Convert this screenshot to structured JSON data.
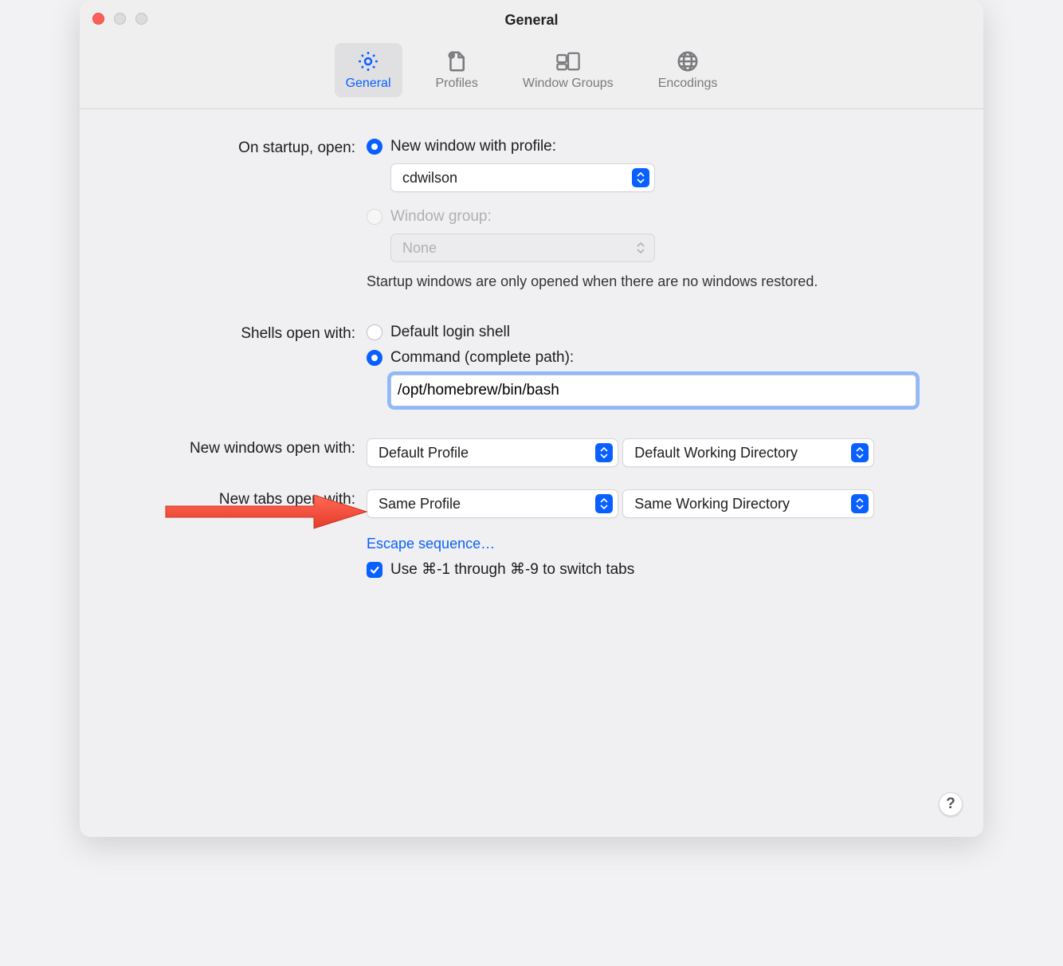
{
  "window": {
    "title": "General"
  },
  "toolbar": {
    "tabs": [
      {
        "label": "General"
      },
      {
        "label": "Profiles"
      },
      {
        "label": "Window Groups"
      },
      {
        "label": "Encodings"
      }
    ]
  },
  "startup": {
    "label": "On startup, open:",
    "option_new_window_label": "New window with profile:",
    "profile_value": "cdwilson",
    "option_window_group_label": "Window group:",
    "window_group_value": "None",
    "hint": "Startup windows are only opened when there are no windows restored."
  },
  "shells": {
    "label": "Shells open with:",
    "option_default_label": "Default login shell",
    "option_command_label": "Command (complete path):",
    "command_value": "/opt/homebrew/bin/bash"
  },
  "new_windows": {
    "label": "New windows open with:",
    "profile_value": "Default Profile",
    "wd_value": "Default Working Directory"
  },
  "new_tabs": {
    "label": "New tabs open with:",
    "profile_value": "Same Profile",
    "wd_value": "Same Working Directory"
  },
  "escape_link": "Escape sequence…",
  "switch_tabs_label": "Use ⌘-1 through ⌘-9 to switch tabs",
  "help_label": "?"
}
